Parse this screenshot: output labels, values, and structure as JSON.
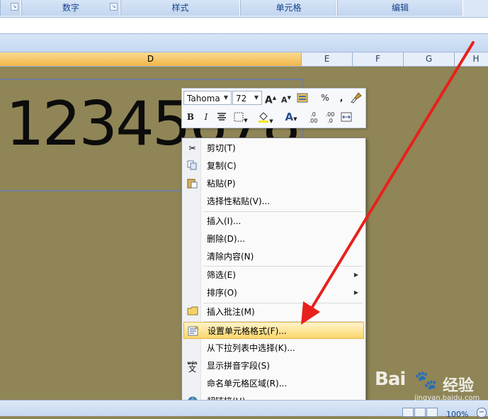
{
  "ribbon": {
    "groups": [
      "",
      "数字",
      "样式",
      "单元格",
      "编辑"
    ],
    "launcher_icon": "dialog-launcher-icon"
  },
  "columns": [
    "D",
    "E",
    "F",
    "G",
    "H"
  ],
  "cell": {
    "value": "12345678"
  },
  "mini_toolbar": {
    "font_name": "Tahoma",
    "font_size": "72",
    "grow_font": "A",
    "shrink_font": "A",
    "percent": "%",
    "comma": ",",
    "bold": "B",
    "italic": "I",
    "font_color": "A",
    "increase_decimal": ".0 .00",
    "decrease_decimal": ".00 .0"
  },
  "context_menu": {
    "items": [
      {
        "label": "剪切(T)",
        "icon": "scissors-icon"
      },
      {
        "label": "复制(C)",
        "icon": "copy-icon"
      },
      {
        "label": "粘贴(P)",
        "icon": "paste-icon"
      },
      {
        "label": "选择性粘贴(V)...",
        "icon": ""
      },
      {
        "label": "插入(I)...",
        "icon": ""
      },
      {
        "label": "删除(D)...",
        "icon": ""
      },
      {
        "label": "清除内容(N)",
        "icon": ""
      },
      {
        "label": "筛选(E)",
        "icon": "",
        "submenu": true
      },
      {
        "label": "排序(O)",
        "icon": "",
        "submenu": true
      },
      {
        "label": "插入批注(M)",
        "icon": "comment-icon"
      },
      {
        "label": "设置单元格格式(F)...",
        "icon": "format-cells-icon",
        "highlighted": true
      },
      {
        "label": "从下拉列表中选择(K)...",
        "icon": ""
      },
      {
        "label": "显示拼音字段(S)",
        "icon": "pinyin-icon"
      },
      {
        "label": "命名单元格区域(R)...",
        "icon": ""
      },
      {
        "label": "超链接(H)...",
        "icon": "hyperlink-icon"
      }
    ]
  },
  "status": {
    "zoom": "100%"
  },
  "watermark": {
    "brand": "Bai",
    "brand_cn": "经验",
    "url": "jingyan.baidu.com"
  },
  "colors": {
    "sheet_bg": "#8f8556",
    "arrow": "#e8201c",
    "highlight": "#fbd66b"
  }
}
